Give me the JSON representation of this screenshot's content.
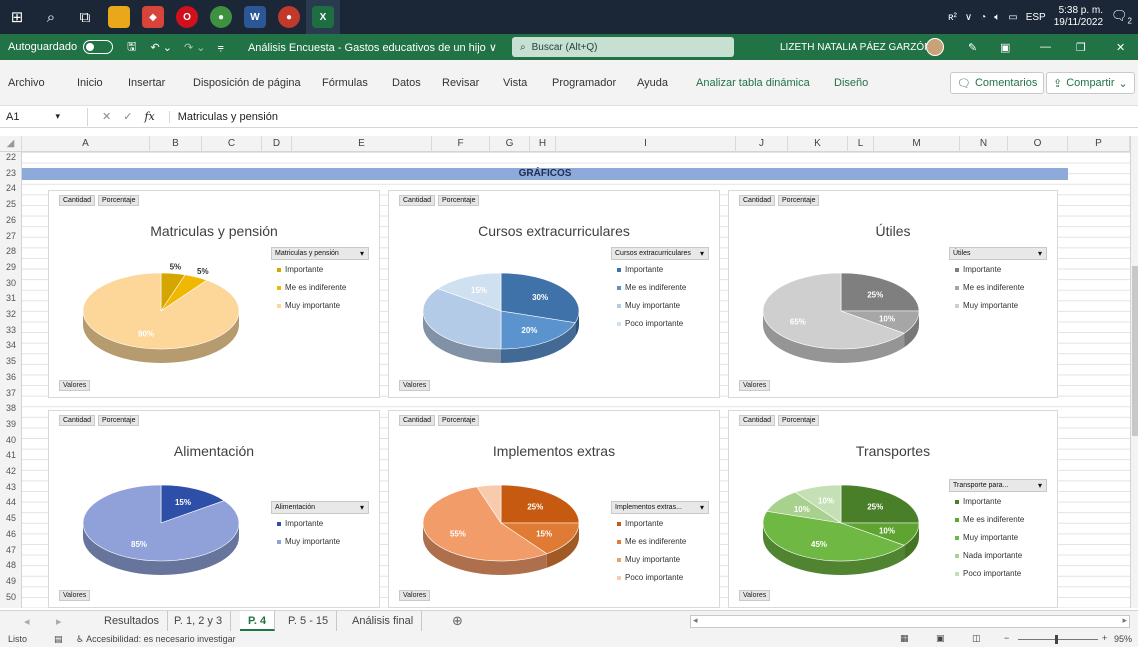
{
  "taskbar": {
    "tray_keyboard": "ESP",
    "time": "5:38 p. m.",
    "date": "19/11/2022",
    "notifications": "2"
  },
  "titlebar": {
    "autosave_label": "Autoguardado",
    "doc_title": "Análisis Encuesta - Gastos educativos de un hijo ∨",
    "search_placeholder": "Buscar (Alt+Q)",
    "user_name": "LIZETH NATALIA PÁEZ GARZÓN"
  },
  "menu": {
    "items": [
      "Archivo",
      "Inicio",
      "Insertar",
      "Disposición de página",
      "Fórmulas",
      "Datos",
      "Revisar",
      "Vista",
      "Programador",
      "Ayuda",
      "Analizar tabla dinámica",
      "Diseño"
    ],
    "comments_label": "Comentarios",
    "share_label": "Compartir"
  },
  "formula": {
    "cell_ref": "A1",
    "fx": "fx",
    "content": "Matriculas y pensión"
  },
  "columns": [
    "A",
    "B",
    "C",
    "D",
    "E",
    "F",
    "G",
    "H",
    "I",
    "J",
    "K",
    "L",
    "M",
    "N",
    "O",
    "P"
  ],
  "rows": [
    "22",
    "23",
    "24",
    "25",
    "26",
    "27",
    "28",
    "29",
    "30",
    "31",
    "32",
    "33",
    "34",
    "35",
    "36",
    "37",
    "38",
    "39",
    "40",
    "41",
    "42",
    "43",
    "44",
    "45",
    "46",
    "47",
    "48",
    "49",
    "50"
  ],
  "banner": "GRÁFICOS",
  "panel_chips": {
    "cantidad": "Cantidad",
    "porcentaje": "Porcentaje",
    "valores": "Valores"
  },
  "chart_data": [
    {
      "type": "pie",
      "title": "Matriculas y pensión",
      "legend_header": "Matriculas y pensión",
      "categories": [
        "Importante",
        "Me es indiferente",
        "Muy importante"
      ],
      "values": [
        5,
        5,
        90
      ],
      "labels": [
        "5%",
        "5%",
        "90%"
      ],
      "colors": [
        "#d6a600",
        "#f0b800",
        "#fdd79a"
      ]
    },
    {
      "type": "pie",
      "title": "Cursos extracurriculares",
      "legend_header": "Cursos extracurriculares",
      "categories": [
        "Importante",
        "Me es indiferente",
        "Muy importante",
        "Poco importante"
      ],
      "values": [
        30,
        20,
        35,
        15
      ],
      "labels": [
        "30%",
        "20%",
        "",
        "15%"
      ],
      "colors": [
        "#3f72a9",
        "#5b93cf",
        "#b3cbe6",
        "#cfe0f1"
      ]
    },
    {
      "type": "pie",
      "title": "Útiles",
      "legend_header": "Útiles",
      "categories": [
        "Importante",
        "Me es indiferente",
        "Muy importante"
      ],
      "values": [
        25,
        10,
        65
      ],
      "labels": [
        "25%",
        "10%",
        "65%"
      ],
      "colors": [
        "#7f7f7f",
        "#a6a6a6",
        "#cfcfcf"
      ]
    },
    {
      "type": "pie",
      "title": "Alimentación",
      "legend_header": "Alimentación",
      "categories": [
        "Importante",
        "Muy importante"
      ],
      "values": [
        15,
        85
      ],
      "labels": [
        "15%",
        "85%"
      ],
      "colors": [
        "#2e4fa8",
        "#8fa1d8"
      ]
    },
    {
      "type": "pie",
      "title": "Implementos extras",
      "legend_header": "Implementos extras...",
      "categories": [
        "Importante",
        "Me es indiferente",
        "Muy importante",
        "Poco importante"
      ],
      "values": [
        25,
        15,
        55,
        5
      ],
      "labels": [
        "25%",
        "15%",
        "55%",
        ""
      ],
      "colors": [
        "#c65a11",
        "#e07b35",
        "#f29c6a",
        "#f8cbad"
      ]
    },
    {
      "type": "pie",
      "title": "Transportes",
      "legend_header": "Transporte para...",
      "categories": [
        "Importante",
        "Me es indiferente",
        "Muy importante",
        "Nada importante",
        "Poco importante"
      ],
      "values": [
        25,
        10,
        45,
        10,
        10
      ],
      "labels": [
        "25%",
        "10%",
        "45%",
        "10%",
        "10%"
      ],
      "colors": [
        "#4a7f2a",
        "#5fa331",
        "#70b844",
        "#a9d18e",
        "#c5e0b4"
      ]
    }
  ],
  "sheets": {
    "tabs": [
      "Resultados",
      "P. 1, 2 y 3",
      "P. 4",
      "P. 5 - 15",
      "Análisis final"
    ],
    "active": "P. 4"
  },
  "status": {
    "ready": "Listo",
    "accessibility": "Accesibilidad: es necesario investigar",
    "zoom": "95%"
  }
}
